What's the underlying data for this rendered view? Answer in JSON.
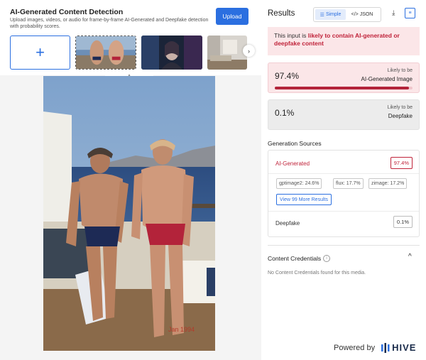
{
  "header": {
    "title": "AI-Generated Content Detection",
    "subtitle": "Upload images, videos, or audio for frame-by-frame AI-Generated and Deepfake detection with probability scores.",
    "upload_label": "Upload"
  },
  "gallery": {
    "add_symbol": "+",
    "next_symbol": "›",
    "collapse_symbol": "^"
  },
  "results": {
    "title": "Results",
    "mode_simple": "Simple",
    "mode_json": "</> JSON",
    "verdict_prefix": "This input is ",
    "verdict_highlight": "likely to contain AI-generated or deepfake content",
    "ai_card": {
      "percent": "97.4%",
      "likely": "Likely to be",
      "name": "AI-Generated Image",
      "fill": 0.974
    },
    "deepfake_card": {
      "percent": "0.1%",
      "likely": "Likely to be",
      "name": "Deepfake"
    }
  },
  "generation": {
    "title": "Generation Sources",
    "ai_label": "AI-Generated",
    "ai_value": "97.4%",
    "chips": [
      "gptimage2: 24.6%",
      "flux: 17.7%",
      "zimage: 17.2%"
    ],
    "more_label": "View 99 More Results",
    "deepfake_label": "Deepfake",
    "deepfake_value": "0.1%"
  },
  "credentials": {
    "title": "Content Credentials",
    "info_symbol": "i",
    "chevron_symbol": "^",
    "text": "No Content Credentials found for this media."
  },
  "footer": {
    "powered_label": "Powered by",
    "brand": "HIVE"
  },
  "colors": {
    "accent": "#2b6fe0",
    "danger": "#c0233a",
    "danger_bg": "#fbe6e8"
  }
}
